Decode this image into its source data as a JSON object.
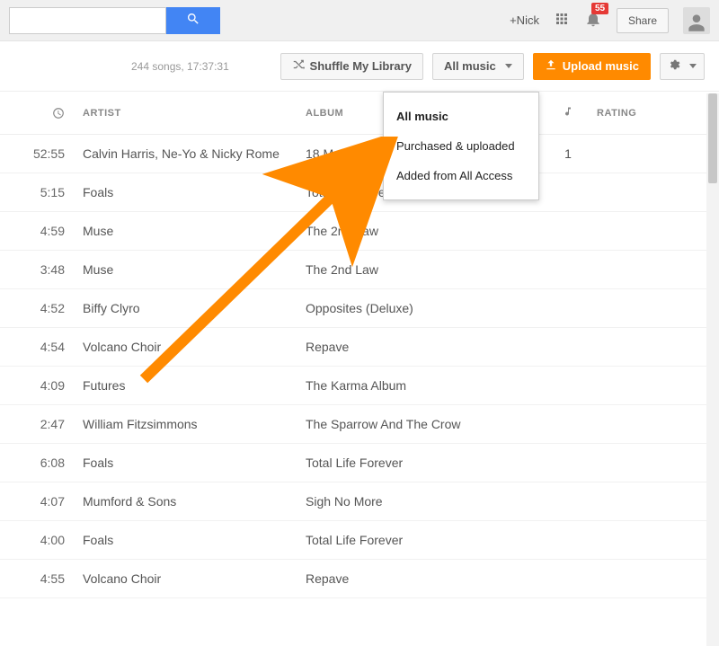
{
  "top": {
    "search_placeholder": "",
    "user_link": "+Nick",
    "notification_count": "55",
    "share_label": "Share"
  },
  "library_bar": {
    "stats": "244 songs, 17:37:31",
    "shuffle_label": "Shuffle My Library",
    "filter_label": "All music",
    "upload_label": "Upload music"
  },
  "filter_menu": {
    "items": [
      "All music",
      "Purchased & uploaded",
      "Added from All Access"
    ]
  },
  "columns": {
    "artist": "ARTIST",
    "album": "ALBUM",
    "rating": "RATING"
  },
  "songs": [
    {
      "dur": "52:55",
      "artist": "Calvin Harris, Ne-Yo & Nicky Rome",
      "album": "18 Mon",
      "plays": "1"
    },
    {
      "dur": "5:15",
      "artist": "Foals",
      "album": "Total Life Forever",
      "plays": ""
    },
    {
      "dur": "4:59",
      "artist": "Muse",
      "album": "The 2nd Law",
      "plays": ""
    },
    {
      "dur": "3:48",
      "artist": "Muse",
      "album": "The 2nd Law",
      "plays": ""
    },
    {
      "dur": "4:52",
      "artist": "Biffy Clyro",
      "album": "Opposites (Deluxe)",
      "plays": ""
    },
    {
      "dur": "4:54",
      "artist": "Volcano Choir",
      "album": "Repave",
      "plays": ""
    },
    {
      "dur": "4:09",
      "artist": "Futures",
      "album": "The Karma Album",
      "plays": ""
    },
    {
      "dur": "2:47",
      "artist": "William Fitzsimmons",
      "album": "The Sparrow And The Crow",
      "plays": ""
    },
    {
      "dur": "6:08",
      "artist": "Foals",
      "album": "Total Life Forever",
      "plays": ""
    },
    {
      "dur": "4:07",
      "artist": "Mumford & Sons",
      "album": "Sigh No More",
      "plays": ""
    },
    {
      "dur": "4:00",
      "artist": "Foals",
      "album": "Total Life Forever",
      "plays": ""
    },
    {
      "dur": "4:55",
      "artist": "Volcano Choir",
      "album": "Repave",
      "plays": ""
    }
  ],
  "colors": {
    "accent": "#ff8a00",
    "blue": "#4285f4",
    "badge": "#e53935"
  }
}
